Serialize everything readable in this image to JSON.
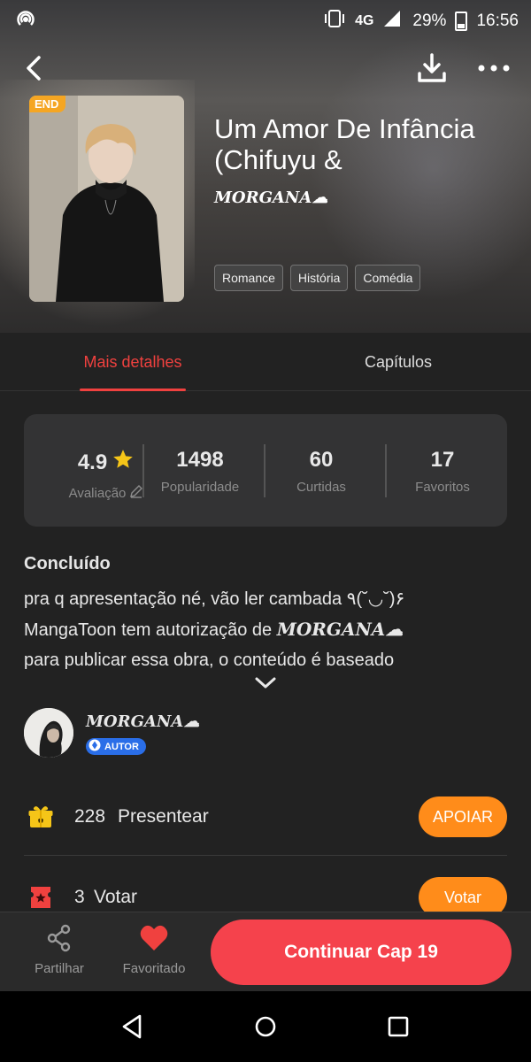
{
  "status_bar": {
    "network": "4G",
    "battery": "29%",
    "battery_level": 0.29,
    "time": "16:56"
  },
  "book": {
    "end_badge": "END",
    "title": "Um Amor De Infância (Chifuyu &",
    "author": "𝑴𝑶𝑹𝑮𝑨𝑵𝑨☁︎",
    "tags": [
      "Romance",
      "História",
      "Comédia"
    ]
  },
  "tabs": {
    "details": "Mais detalhes",
    "chapters": "Capítulos"
  },
  "stats": {
    "rating_value": "4.9",
    "rating_label": "Avaliação",
    "popularity_value": "1498",
    "popularity_label": "Popularidade",
    "likes_value": "60",
    "likes_label": "Curtidas",
    "favorites_value": "17",
    "favorites_label": "Favoritos"
  },
  "description": {
    "status": "Concluído",
    "line1": "pra q apresentação né, vão ler cambada ٩(˘◡˘)۶",
    "line2_prefix": "MangaToon tem autorização de ",
    "line2_author": "𝑴𝑶𝑹𝑮𝑨𝑵𝑨☁︎",
    "line3": "para publicar essa obra, o conteúdo é baseado"
  },
  "author_section": {
    "name": "𝑴𝑶𝑹𝑮𝑨𝑵𝑨☁︎",
    "badge": "AUTOR"
  },
  "gift": {
    "count": "228",
    "label": "Presentear",
    "button": "APOIAR"
  },
  "vote": {
    "count": "3",
    "label": "Votar",
    "button": "Votar"
  },
  "bottom_bar": {
    "share": "Partilhar",
    "favorite": "Favoritado",
    "continue": "Continuar Cap 19"
  },
  "colors": {
    "accent_red": "#f0413f",
    "orange": "#ff8c1a",
    "star": "#f5c518",
    "gift_yellow": "#f5c518",
    "vote_red": "#f0413f",
    "badge_blue": "#2a6ee8"
  },
  "icons": {
    "hotspot": "hotspot-icon",
    "vibrate": "vibrate-icon",
    "signal": "signal-icon",
    "back": "back-arrow-icon",
    "download": "download-icon",
    "more": "more-dots-icon",
    "star": "star-icon",
    "edit": "pencil-icon",
    "expand": "chevron-down-icon",
    "gift": "gift-icon",
    "ticket": "ticket-icon",
    "share": "share-icon",
    "heart": "heart-icon",
    "nav_back": "nav-back-icon",
    "nav_home": "nav-home-icon",
    "nav_recent": "nav-recent-icon"
  }
}
